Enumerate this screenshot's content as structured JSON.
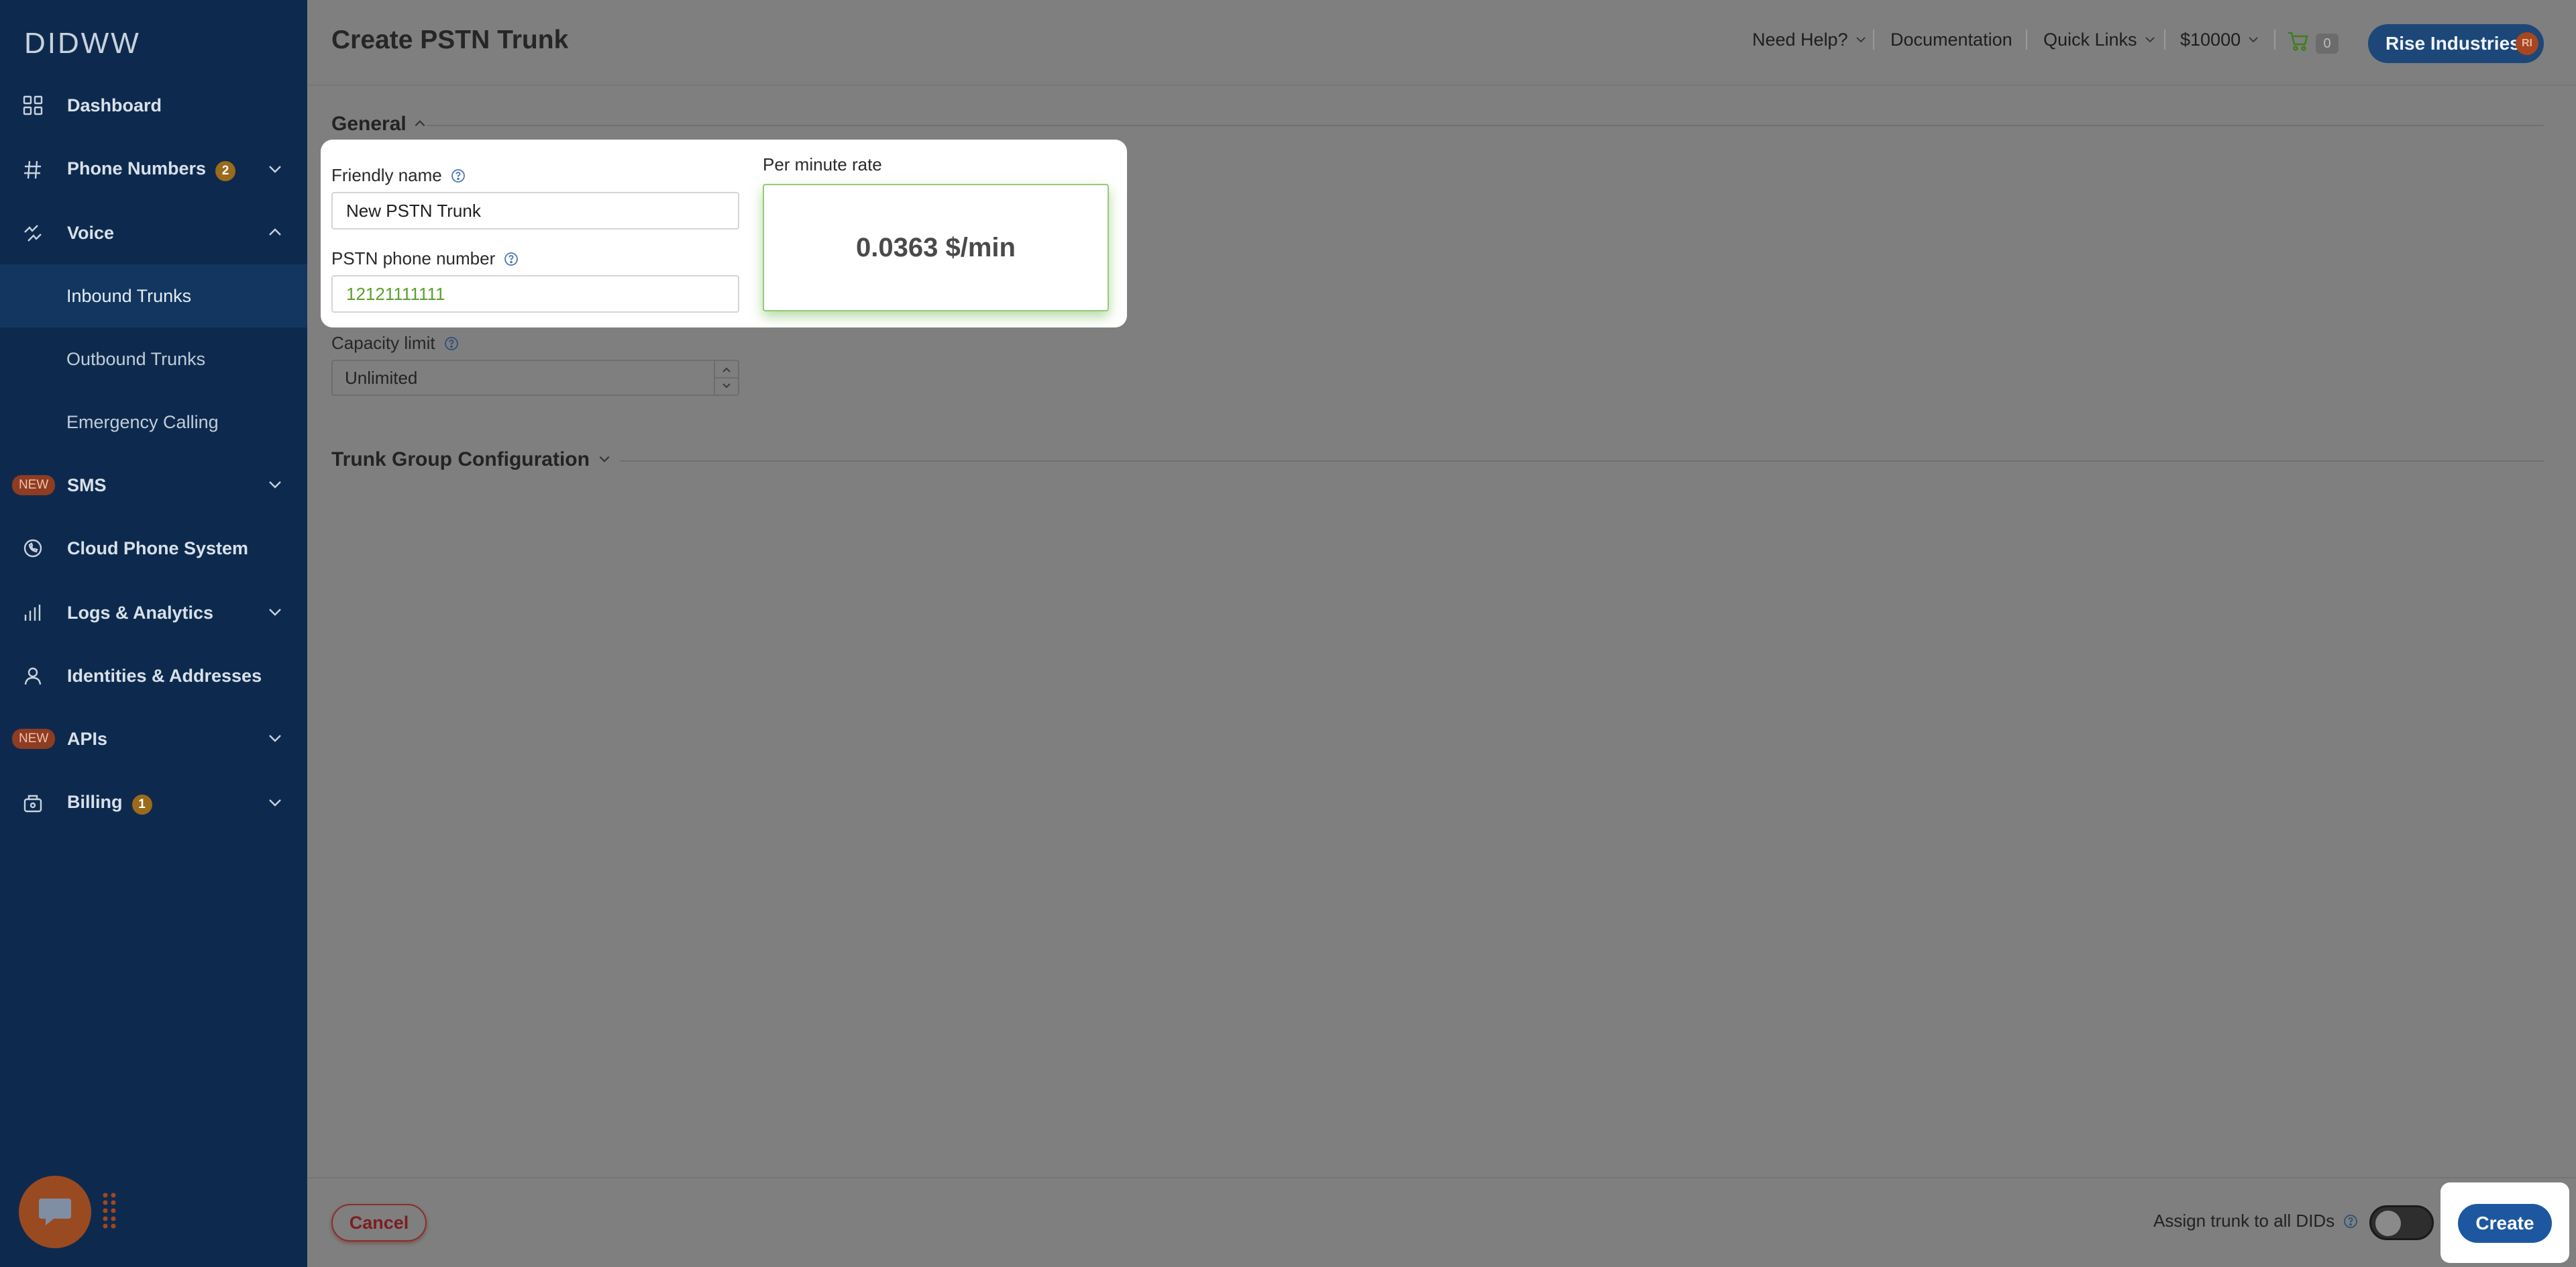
{
  "brand": {
    "logo_text": "DIDWW"
  },
  "sidebar": {
    "items": [
      {
        "label": "Dashboard",
        "icon": "grid-icon"
      },
      {
        "label": "Phone Numbers",
        "icon": "hash-icon",
        "badge": "2"
      },
      {
        "label": "Voice",
        "icon": "voice-icon"
      },
      {
        "label": "Inbound Trunks"
      },
      {
        "label": "Outbound Trunks"
      },
      {
        "label": "Emergency Calling"
      },
      {
        "label": "SMS",
        "new_label": "NEW"
      },
      {
        "label": "Cloud Phone System",
        "icon": "phone-circle-icon"
      },
      {
        "label": "Logs & Analytics",
        "icon": "bar-chart-icon"
      },
      {
        "label": "Identities & Addresses",
        "icon": "user-icon"
      },
      {
        "label": "APIs",
        "new_label": "NEW"
      },
      {
        "label": "Billing",
        "icon": "wallet-icon",
        "badge": "1"
      }
    ]
  },
  "header": {
    "title": "Create PSTN Trunk",
    "need_help": "Need Help?",
    "documentation": "Documentation",
    "quick_links": "Quick Links",
    "balance": "$10000",
    "cart_count": "0",
    "account_name": "Rise Industries",
    "account_initials": "RI"
  },
  "general": {
    "section_title": "General",
    "friendly_name_label": "Friendly name",
    "friendly_name_value": "New PSTN Trunk",
    "pstn_label": "PSTN phone number",
    "pstn_value": "12121111111",
    "rate_label": "Per minute rate",
    "rate_value": "0.0363 $/min",
    "capacity_label": "Capacity limit",
    "capacity_value": "Unlimited"
  },
  "trunk_group": {
    "section_title": "Trunk Group Configuration"
  },
  "footer": {
    "cancel": "Cancel",
    "assign_label": "Assign trunk to all DIDs",
    "create": "Create"
  },
  "colors": {
    "sidebar_bg": "#0d2a4e",
    "accent_blue": "#1d57a0",
    "rate_border": "#95c97a",
    "pstn_text": "#5aa02c",
    "cancel_red": "#8a2d2d"
  }
}
